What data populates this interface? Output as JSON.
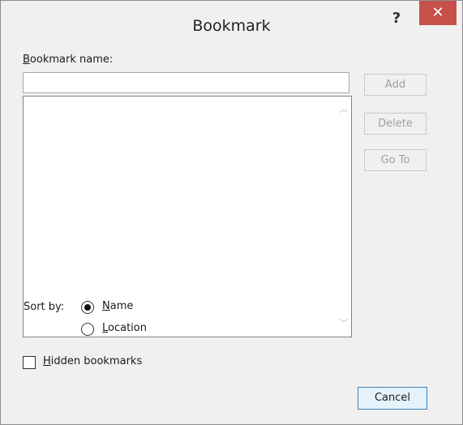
{
  "window": {
    "title": "Bookmark",
    "help_label": "?",
    "close_label": "✕"
  },
  "form": {
    "name_label_accel": "B",
    "name_label_rest": "ookmark name:",
    "name_value": "",
    "list_items": [],
    "sort_by_label": "Sort by:",
    "sort_options": [
      {
        "accel": "N",
        "rest": "ame",
        "selected": true
      },
      {
        "accel": "L",
        "rest": "ocation",
        "selected": false
      }
    ],
    "hidden_accel": "H",
    "hidden_rest": "idden bookmarks",
    "hidden_checked": false
  },
  "buttons": {
    "add": "Add",
    "delete": "Delete",
    "goto": "Go To",
    "cancel": "Cancel"
  },
  "icons": {
    "scroll_up": "chevron-up-icon",
    "scroll_down": "chevron-down-icon"
  },
  "colors": {
    "close_bg": "#c7504b",
    "dialog_bg": "#f0f0f0",
    "cancel_border": "#3c7fb1"
  }
}
